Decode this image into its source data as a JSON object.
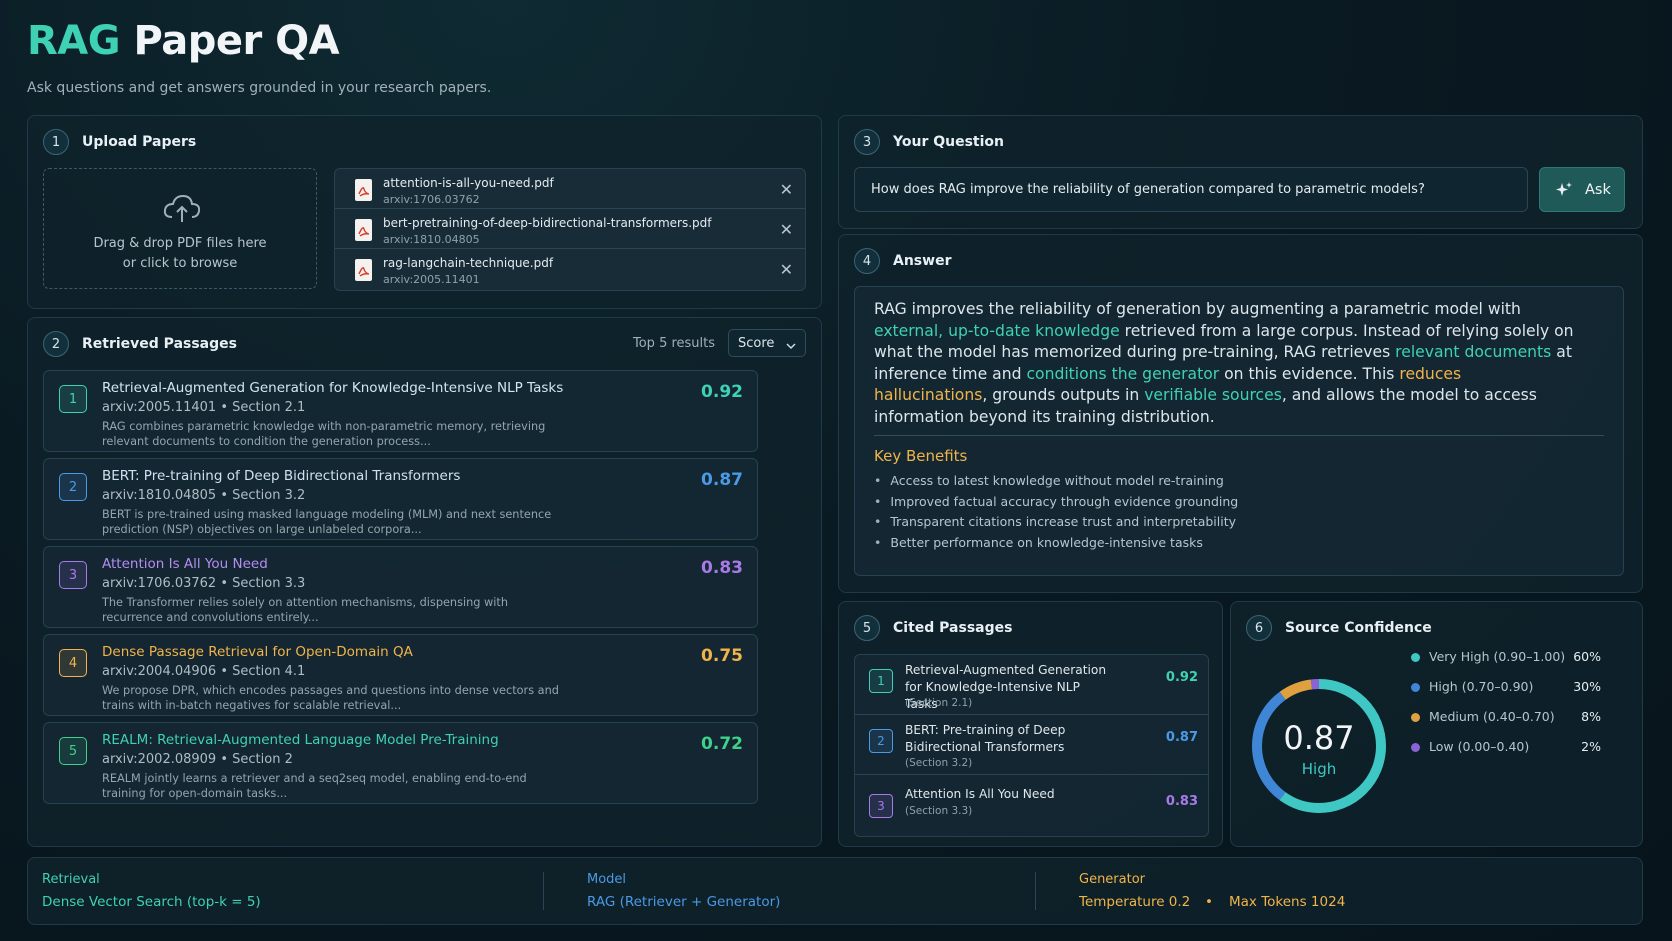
{
  "header": {
    "title_part1": "RAG",
    "title_part2": "Paper QA",
    "subtitle": "Ask questions and get answers grounded in your research papers."
  },
  "upload": {
    "step": "1",
    "title": "Upload Papers",
    "drop_line1": "Drag & drop PDF files here",
    "drop_line2": "or click to browse",
    "files": [
      {
        "name": "attention-is-all-you-need.pdf",
        "id": "arxiv:1706.03762"
      },
      {
        "name": "bert-pretraining-of-deep-bidirectional-transformers.pdf",
        "id": "arxiv:1810.04805"
      },
      {
        "name": "rag-langchain-technique.pdf",
        "id": "arxiv:2005.11401"
      }
    ],
    "close_glyph": "✕"
  },
  "retrieved": {
    "step": "2",
    "title": "Retrieved Passages",
    "results_label": "Top 5 results",
    "sort_value": "Score",
    "items": [
      {
        "num": "1",
        "title": "Retrieval-Augmented Generation for Knowledge-Intensive NLP Tasks",
        "meta": "arxiv:2005.11401  •  Section 2.1",
        "snippet": "RAG combines parametric knowledge with non-parametric memory, retrieving relevant documents to condition the generation process...",
        "score": "0.92",
        "color": "#3fd1b4",
        "title_color": "#cfe8f0"
      },
      {
        "num": "2",
        "title": "BERT: Pre-training of Deep Bidirectional Transformers",
        "meta": "arxiv:1810.04805  •  Section 3.2",
        "snippet": "BERT is pre-trained using masked language modeling (MLM) and next sentence prediction (NSP) objectives on large unlabeled corpora...",
        "score": "0.87",
        "color": "#4a9ae6",
        "title_color": "#cfe0f0"
      },
      {
        "num": "3",
        "title": "Attention Is All You Need",
        "meta": "arxiv:1706.03762  •  Section 3.3",
        "snippet": "The Transformer relies solely on attention mechanisms, dispensing with recurrence and convolutions entirely...",
        "score": "0.83",
        "color": "#a67be8",
        "title_color": "#b58cf0"
      },
      {
        "num": "4",
        "title": "Dense Passage Retrieval for Open-Domain QA",
        "meta": "arxiv:2004.04906  •  Section 4.1",
        "snippet": "We propose DPR, which encodes passages and questions into dense vectors and trains with in-batch negatives for scalable retrieval...",
        "score": "0.75",
        "color": "#f0b44a",
        "title_color": "#f0b44a"
      },
      {
        "num": "5",
        "title": "REALM: Retrieval-Augmented Language Model Pre-Training",
        "meta": "arxiv:2002.08909  •  Section 2",
        "snippet": "REALM jointly learns a retriever and a seq2seq model, enabling end-to-end training for open-domain tasks...",
        "score": "0.72",
        "color": "#3fd18a",
        "title_color": "#3fd1b4"
      }
    ]
  },
  "question": {
    "step": "3",
    "title": "Your Question",
    "value": "How does RAG improve the reliability of generation compared to parametric models?",
    "ask_label": "Ask"
  },
  "answer": {
    "step": "4",
    "title": "Answer",
    "segments": [
      {
        "t": "RAG improves the reliability of generation by augmenting a parametric model with ",
        "c": ""
      },
      {
        "t": "external, up-to-date knowledge",
        "c": "hl-teal"
      },
      {
        "t": " retrieved from a large corpus. Instead of relying solely on what the model has memorized during pre-training, RAG retrieves ",
        "c": ""
      },
      {
        "t": "relevant documents",
        "c": "hl-teal"
      },
      {
        "t": " at inference time and ",
        "c": ""
      },
      {
        "t": "conditions the generator",
        "c": "hl-teal"
      },
      {
        "t": " on this evidence. This ",
        "c": ""
      },
      {
        "t": "reduces hallucinations",
        "c": "hl-orange"
      },
      {
        "t": ", grounds outputs in ",
        "c": ""
      },
      {
        "t": "verifiable sources",
        "c": "hl-teal"
      },
      {
        "t": ", and allows the model to access information beyond its training distribution.",
        "c": ""
      }
    ],
    "benefits_title": "Key Benefits",
    "benefits": [
      "Access to latest knowledge without model re-training",
      "Improved factual accuracy through evidence grounding",
      "Transparent citations increase trust and interpretability",
      "Better performance on knowledge-intensive tasks"
    ]
  },
  "cited": {
    "step": "5",
    "title": "Cited Passages",
    "items": [
      {
        "num": "1",
        "title": "Retrieval-Augmented Generation for Knowledge-Intensive NLP Tasks",
        "section": "(Section 2.1)",
        "score": "0.92",
        "color": "#3fd1b4"
      },
      {
        "num": "2",
        "title": "BERT: Pre-training of Deep Bidirectional Transformers",
        "section": "(Section 3.2)",
        "score": "0.87",
        "color": "#4a9ae6"
      },
      {
        "num": "3",
        "title": "Attention Is All You Need",
        "section": "(Section 3.3)",
        "score": "0.83",
        "color": "#a67be8"
      }
    ]
  },
  "confidence": {
    "step": "6",
    "title": "Source Confidence",
    "value": "0.87",
    "level": "High",
    "legend": [
      {
        "label": "Very High (0.90–1.00)",
        "pct": "60%",
        "share": 0.6,
        "color": "#3fc7c4"
      },
      {
        "label": "High (0.70–0.90)",
        "pct": "30%",
        "share": 0.3,
        "color": "#3f86d6"
      },
      {
        "label": "Medium (0.40–0.70)",
        "pct": "8%",
        "share": 0.08,
        "color": "#e0a040"
      },
      {
        "label": "Low (0.00–0.40)",
        "pct": "2%",
        "share": 0.02,
        "color": "#8a63d6"
      }
    ]
  },
  "footer": {
    "retrieval_label": "Retrieval",
    "retrieval_value": "Dense Vector Search (top-k = 5)",
    "model_label": "Model",
    "model_value": "RAG (Retriever + Generator)",
    "generator_label": "Generator",
    "temperature": "Temperature 0.2",
    "separator": "•",
    "max_tokens": "Max Tokens 1024"
  }
}
